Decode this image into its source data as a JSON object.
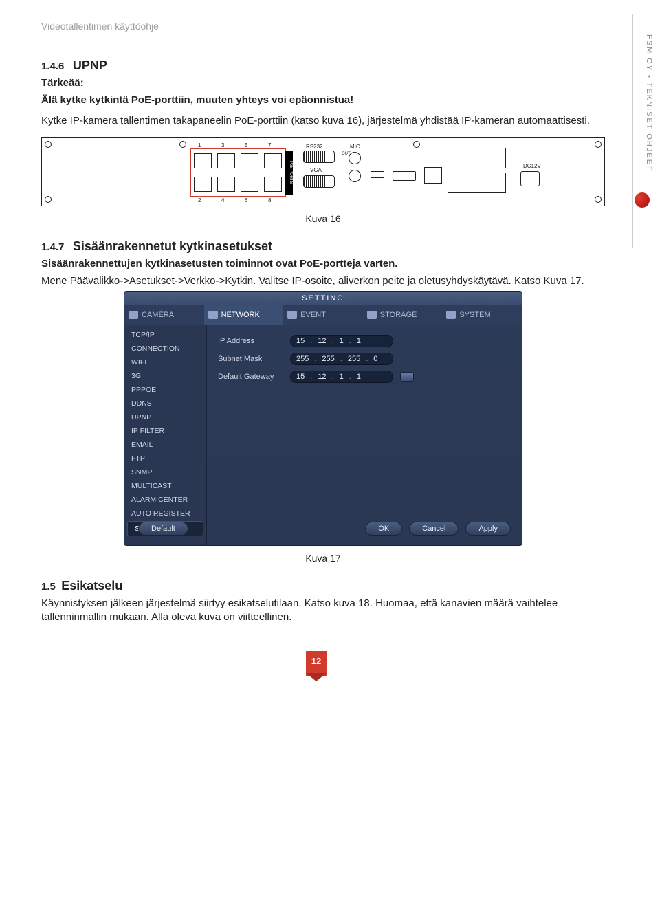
{
  "header": {
    "doc_title": "Videotallentimen käyttöohje"
  },
  "section_146": {
    "num": "1.4.6",
    "title": "UPNP",
    "important_label": "Tärkeää:",
    "important_text": "Älä kytke kytkintä PoE-porttiin, muuten yhteys voi epäonnistua!",
    "body": "Kytke IP-kamera tallentimen takapaneelin PoE-porttiin (katso kuva 16), järjestelmä yhdistää IP-kameran automaattisesti."
  },
  "fig16_caption": "Kuva 16",
  "panel": {
    "poe_label": "PoE PORTS",
    "port_nums_top": [
      "1",
      "3",
      "5",
      "7"
    ],
    "port_nums_bottom": [
      "2",
      "4",
      "6",
      "8"
    ],
    "rs232": "RS232",
    "vga": "VGA",
    "mic": "MIC",
    "out": "OUT",
    "dc": "DC12V"
  },
  "section_147": {
    "num": "1.4.7",
    "title": "Sisäänrakennetut kytkinasetukset",
    "line1": "Sisäänrakennettujen kytkinasetusten toiminnot ovat PoE-portteja varten.",
    "line2": "Mene Päävalikko->Asetukset->Verkko->Kytkin. Valitse IP-osoite, aliverkon peite ja oletusyhdyskäytävä. Katso Kuva 17."
  },
  "settings": {
    "title": "SETTING",
    "tabs": [
      "CAMERA",
      "NETWORK",
      "EVENT",
      "STORAGE",
      "SYSTEM"
    ],
    "active_tab": 1,
    "sidebar": [
      "TCP/IP",
      "CONNECTION",
      "WIFI",
      "3G",
      "PPPOE",
      "DDNS",
      "UPNP",
      "IP FILTER",
      "EMAIL",
      "FTP",
      "SNMP",
      "MULTICAST",
      "ALARM CENTER",
      "AUTO REGISTER",
      "SWITCH"
    ],
    "active_item": 14,
    "fields": {
      "ip_label": "IP Address",
      "ip_value": [
        "15",
        "12",
        "1",
        "1"
      ],
      "mask_label": "Subnet Mask",
      "mask_value": [
        "255",
        "255",
        "255",
        "0"
      ],
      "gw_label": "Default Gateway",
      "gw_value": [
        "15",
        "12",
        "1",
        "1"
      ]
    },
    "buttons": {
      "default": "Default",
      "ok": "OK",
      "cancel": "Cancel",
      "apply": "Apply"
    }
  },
  "fig17_caption": "Kuva 17",
  "section_15": {
    "num": "1.5",
    "title": "Esikatselu",
    "body": "Käynnistyksen jälkeen järjestelmä siirtyy esikatselutilaan. Katso kuva 18. Huomaa, että kanavien määrä vaihtelee tallenninmallin mukaan. Alla oleva kuva on viitteellinen."
  },
  "side_tab": "FSM OY • TEKNISET OHJEET",
  "page_number": "12"
}
